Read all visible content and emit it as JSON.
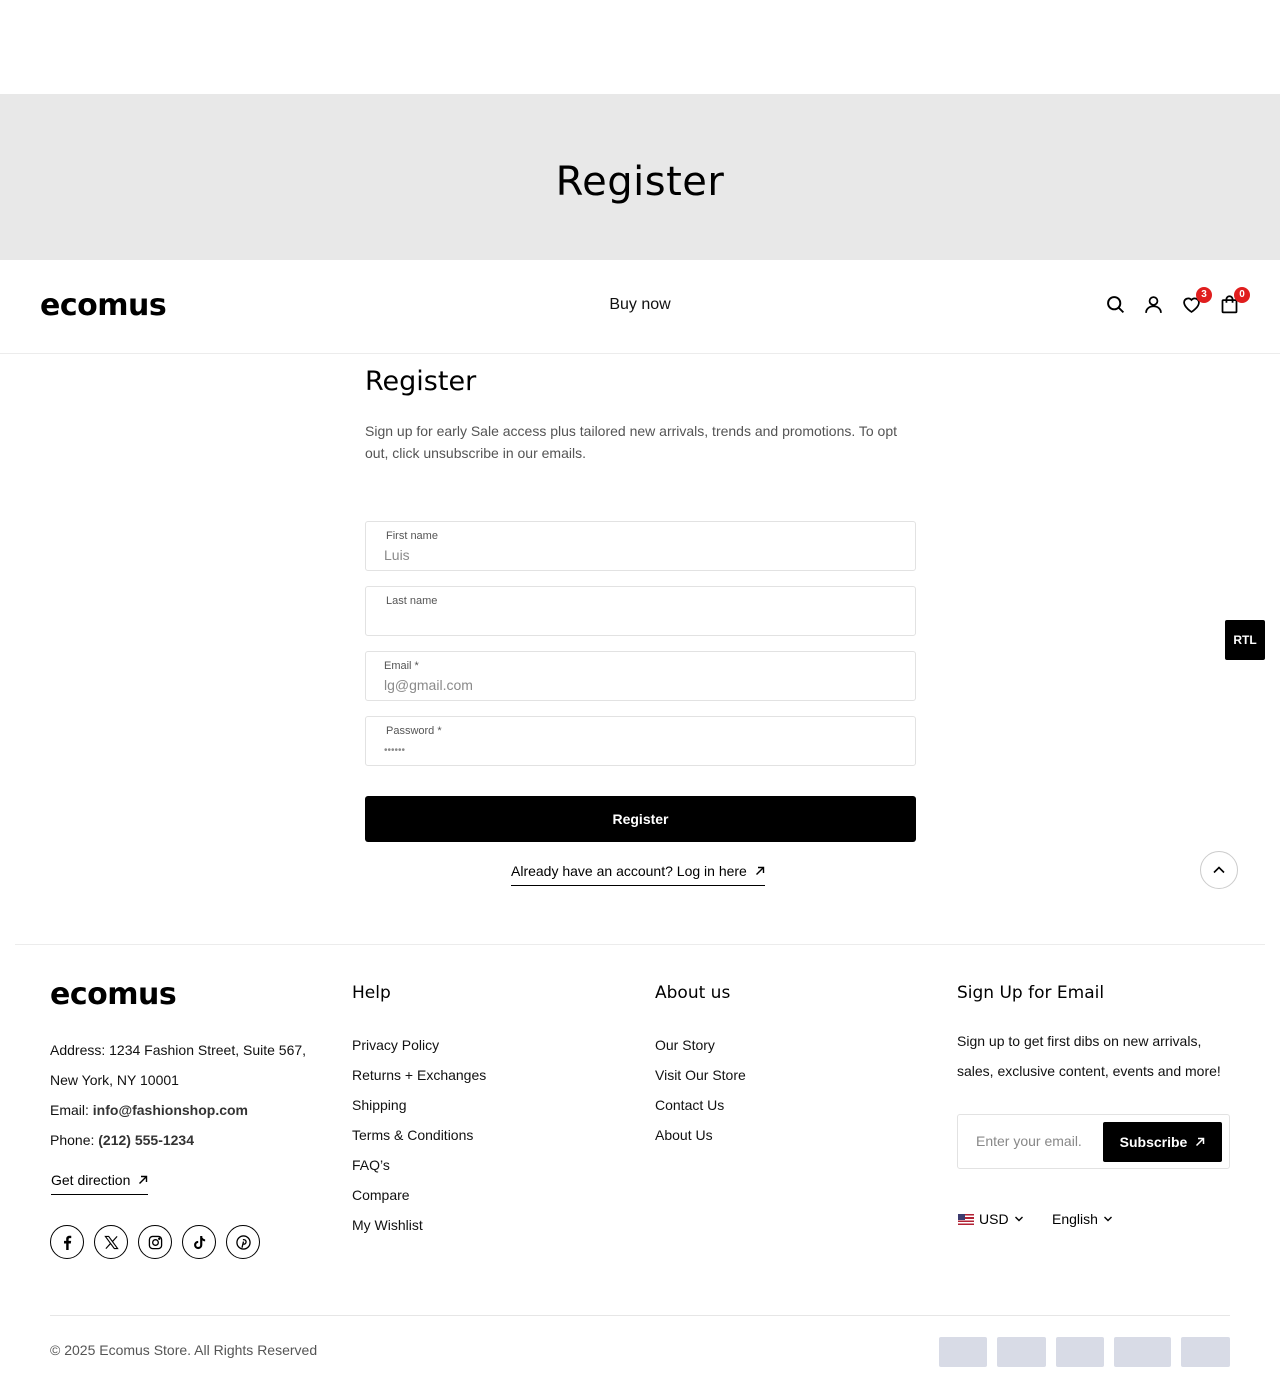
{
  "banner": {
    "title": "Register"
  },
  "header": {
    "logo": "ecomus",
    "nav_link": "Buy now",
    "wishlist_count": "3",
    "cart_count": "0"
  },
  "register": {
    "title": "Register",
    "description": "Sign up for early Sale access plus tailored new arrivals, trends and promotions. To opt out, click unsubscribe in our emails.",
    "first_name": {
      "label": "First name",
      "value": "Luis"
    },
    "last_name": {
      "label": "Last name",
      "value": ""
    },
    "email": {
      "label": "Email *",
      "value": "lg@gmail.com"
    },
    "password": {
      "label": "Password *",
      "value": "••••••"
    },
    "submit_label": "Register",
    "login_link": "Already have an account? Log in here"
  },
  "floating": {
    "rtl_label": "RTL"
  },
  "footer": {
    "logo": "ecomus",
    "address_label": "Address:",
    "address_line1": "1234 Fashion Street, Suite 567,",
    "address_line2": "New York, NY 10001",
    "email_label": "Email:",
    "email_value": "info@fashionshop.com",
    "phone_label": "Phone:",
    "phone_value": "(212) 555-1234",
    "get_direction": "Get direction",
    "help": {
      "title": "Help",
      "items": [
        "Privacy Policy",
        "Returns + Exchanges",
        "Shipping",
        "Terms & Conditions",
        "FAQ’s",
        "Compare",
        "My Wishlist"
      ]
    },
    "about": {
      "title": "About us",
      "items": [
        "Our Story",
        "Visit Our Store",
        "Contact Us",
        "About Us"
      ]
    },
    "signup": {
      "title": "Sign Up for Email",
      "text": "Sign up to get first dibs on new arrivals, sales, exclusive content, events and more!",
      "placeholder": "Enter your email.",
      "button": "Subscribe"
    },
    "currency": "USD",
    "language": "English",
    "copyright": "© 2025 Ecomus Store. All Rights Reserved",
    "socials": [
      "facebook-icon",
      "x-icon",
      "instagram-icon",
      "tiktok-icon",
      "pinterest-icon"
    ]
  },
  "colors": {
    "banner_bg": "#e8e8e8",
    "accent": "#000000",
    "badge": "#e01e1e"
  }
}
